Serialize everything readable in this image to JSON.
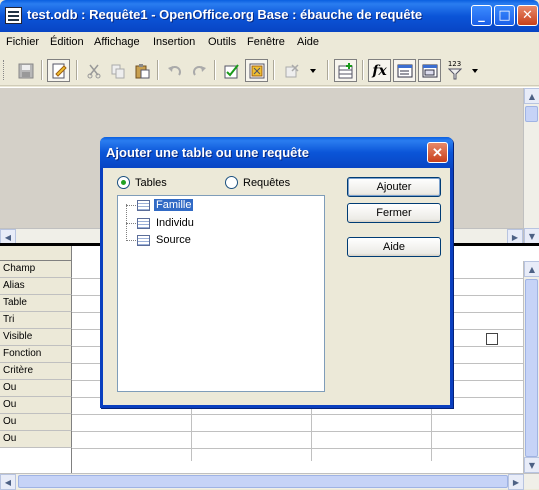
{
  "window": {
    "title": "test.odb : Requête1 - OpenOffice.org Base : ébauche de requête",
    "minimize_label": "_",
    "maximize_label": "□",
    "close_label": "✕"
  },
  "menubar": {
    "items": [
      "Fichier",
      "Édition",
      "Affichage",
      "Insertion",
      "Outils",
      "Fenêtre",
      "Aide"
    ]
  },
  "toolbar": {
    "buttons": [
      "save-icon",
      "edit-mode-icon",
      "cut-icon",
      "copy-icon",
      "paste-icon",
      "undo-icon",
      "redo-icon",
      "run-query-icon",
      "clear-query-icon",
      "delete-icon",
      "add-table-icon",
      "functions-icon",
      "table-name-icon",
      "alias-icon",
      "distinct-values-icon"
    ],
    "functions_glyph": "fx",
    "distinct_glyph": "123"
  },
  "grid": {
    "row_labels": [
      "Champ",
      "Alias",
      "Table",
      "Tri",
      "Visible",
      "Fonction",
      "Critère",
      "Ou",
      "Ou",
      "Ou",
      "Ou"
    ]
  },
  "dialog": {
    "title": "Ajouter une table ou une requête",
    "close_label": "✕",
    "radio_tables": "Tables",
    "radio_queries": "Requêtes",
    "selected_radio": "Tables",
    "tables": [
      "Famille",
      "Individu",
      "Source"
    ],
    "selected_table": "Famille",
    "buttons": {
      "add": "Ajouter",
      "close": "Fermer",
      "help": "Aide"
    }
  },
  "colors": {
    "titlebar": "#0b55d8",
    "selection": "#316ac5",
    "window_bg": "#ece9d8"
  }
}
